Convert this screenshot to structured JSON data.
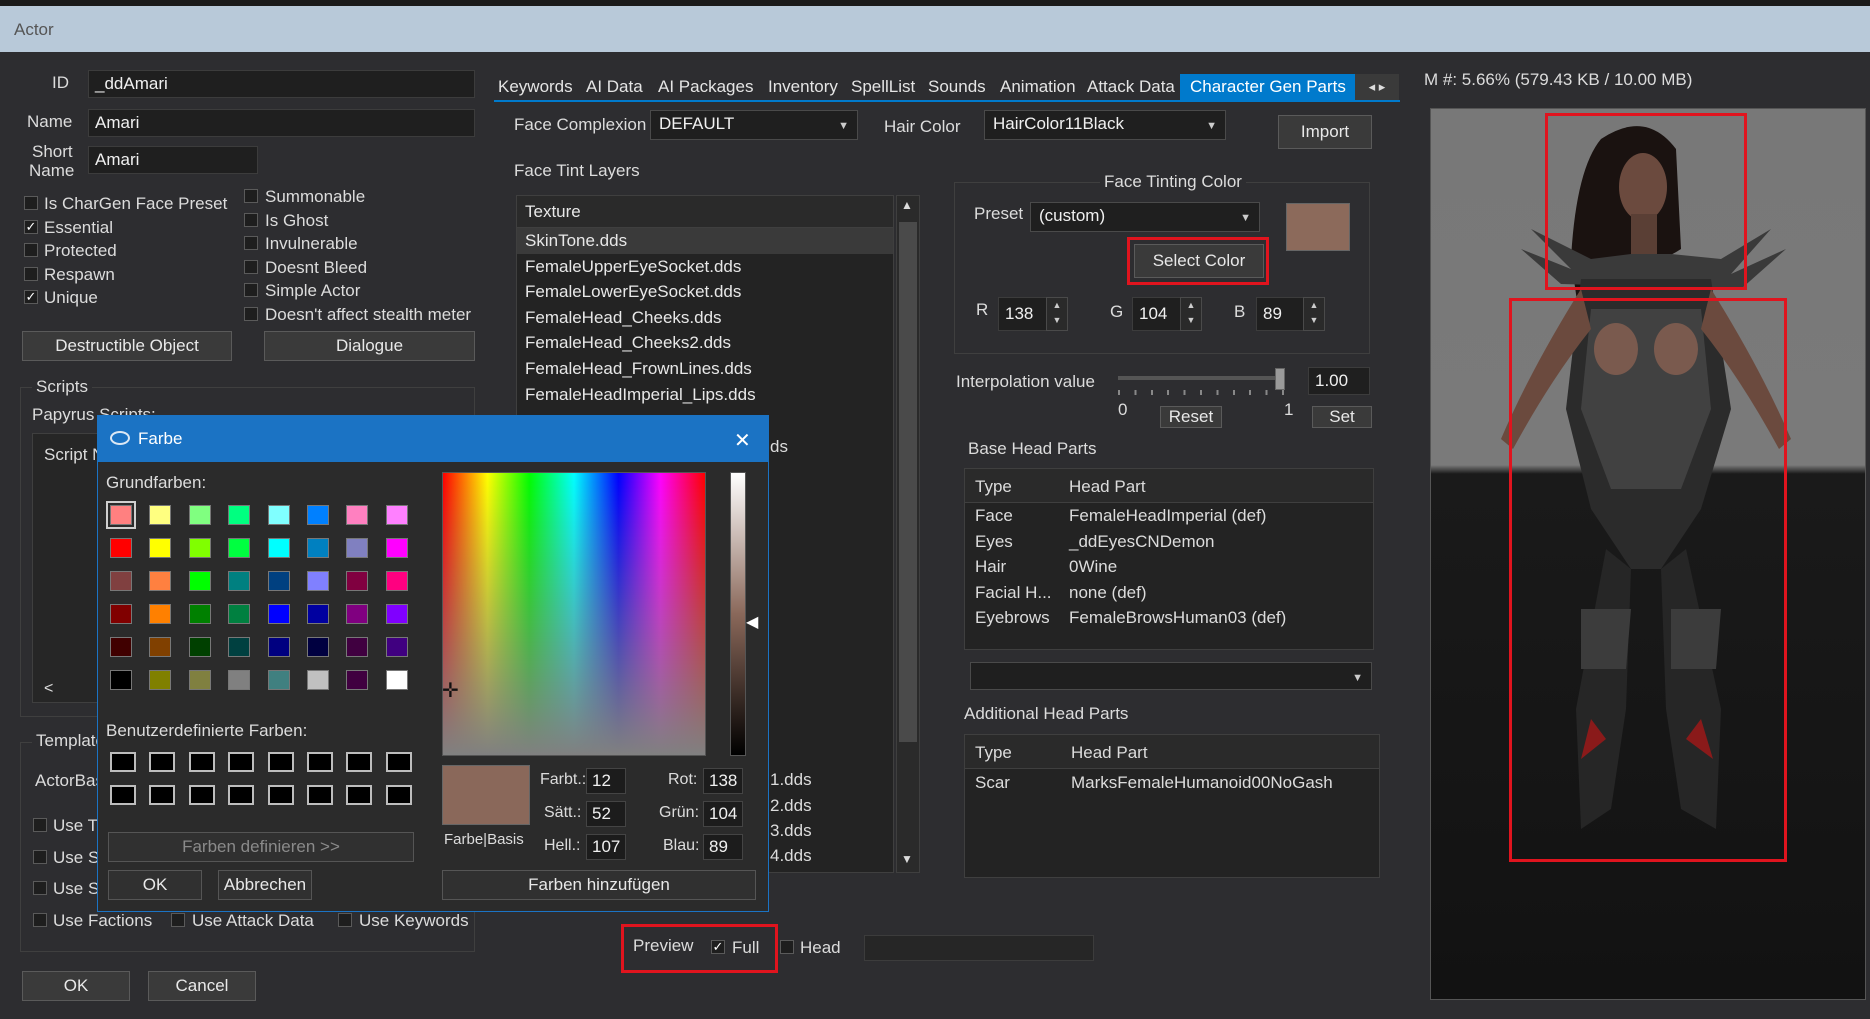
{
  "window": {
    "title": "Actor"
  },
  "actor": {
    "id_label": "ID",
    "id_value": "_ddAmari",
    "name_label": "Name",
    "name_value": "Amari",
    "short_name_label_1": "Short",
    "short_name_label_2": "Name",
    "short_name_value": "Amari"
  },
  "flags_left": [
    {
      "label": "Is CharGen Face Preset",
      "checked": false
    },
    {
      "label": "Essential",
      "checked": true
    },
    {
      "label": "Protected",
      "checked": false
    },
    {
      "label": "Respawn",
      "checked": false
    },
    {
      "label": "Unique",
      "checked": true
    }
  ],
  "flags_right": [
    {
      "label": "Summonable",
      "checked": false
    },
    {
      "label": "Is Ghost",
      "checked": false
    },
    {
      "label": "Invulnerable",
      "checked": false
    },
    {
      "label": "Doesnt Bleed",
      "checked": false
    },
    {
      "label": "Simple Actor",
      "checked": false
    },
    {
      "label": "Doesn't affect stealth meter",
      "checked": false
    }
  ],
  "buttons": {
    "destructible": "Destructible Object",
    "dialogue": "Dialogue",
    "ok": "OK",
    "cancel": "Cancel",
    "import": "Import",
    "select_color": "Select Color",
    "reset": "Reset",
    "set": "Set"
  },
  "scripts": {
    "group_label": "Scripts",
    "papyrus_label": "Papyrus Scripts:",
    "column": "Script N",
    "scroll_left": "<"
  },
  "template": {
    "group_label": "Template",
    "actorbase_label": "ActorBase",
    "use_rows": [
      "Use T",
      "Use S",
      "Use S"
    ],
    "bottom_flags": [
      "Use Factions",
      "Use Attack Data",
      "Use Keywords"
    ]
  },
  "tabs": [
    "Keywords",
    "AI Data",
    "AI Packages",
    "Inventory",
    "SpellList",
    "Sounds",
    "Animation",
    "Attack Data",
    "Character Gen Parts"
  ],
  "tab_arrows": "◂  ▸",
  "chargen": {
    "face_complexion_label": "Face Complexion",
    "face_complexion_value": "DEFAULT",
    "hair_color_label": "Hair Color",
    "hair_color_value": "HairColor11Black",
    "face_tint_layers_label": "Face Tint Layers",
    "texture_header": "Texture",
    "textures": [
      "SkinTone.dds",
      "FemaleUpperEyeSocket.dds",
      "FemaleLowerEyeSocket.dds",
      "FemaleHead_Cheeks.dds",
      "FemaleHead_Cheeks2.dds",
      "FemaleHead_FrownLines.dds",
      "FemaleHeadImperial_Lips.dds"
    ],
    "texture_fragments": [
      "ds",
      "1.dds",
      "2.dds",
      "3.dds",
      "4.dds"
    ],
    "tint_color_title": "Face Tinting Color",
    "preset_label": "Preset",
    "preset_value": "(custom)",
    "tint_color": "#8c6a5b",
    "r_label": "R",
    "r_value": "138",
    "g_label": "G",
    "g_value": "104",
    "b_label": "B",
    "b_value": "89",
    "interp_label": "Interpolation value",
    "interp_value": "1.00",
    "interp_min": "0",
    "interp_max": "1",
    "interp_level": 1.0,
    "base_head_parts_label": "Base Head Parts",
    "head_cols": [
      "Type",
      "Head Part"
    ],
    "base_head_parts": [
      {
        "type": "Face",
        "part": "FemaleHeadImperial (def)"
      },
      {
        "type": "Eyes",
        "part": "_ddEyesCNDemon"
      },
      {
        "type": "Hair",
        "part": "0Wine"
      },
      {
        "type": "Facial H...",
        "part": "none (def)"
      },
      {
        "type": "Eyebrows",
        "part": "FemaleBrowsHuman03 (def)"
      }
    ],
    "additional_head_parts_label": "Additional Head Parts",
    "additional_head_parts": [
      {
        "type": "Scar",
        "part": "MarksFemaleHumanoid00NoGash"
      }
    ],
    "preview_label": "Preview",
    "full_label": "Full",
    "full_checked": true,
    "head_label": "Head",
    "head_checked": false
  },
  "memory": {
    "text": "M #: 5.66% (579.43 KB / 10.00 MB)"
  },
  "color_dialog": {
    "title": "Farbe",
    "basic_colors_label": "Grundfarben:",
    "basic_colors": [
      "#ff8080",
      "#ffff80",
      "#80ff80",
      "#00ff80",
      "#80ffff",
      "#0080ff",
      "#ff80c0",
      "#ff80ff",
      "#ff0000",
      "#ffff00",
      "#80ff00",
      "#00ff40",
      "#00ffff",
      "#0080c0",
      "#8080c0",
      "#ff00ff",
      "#804040",
      "#ff8040",
      "#00ff00",
      "#008080",
      "#004080",
      "#8080ff",
      "#800040",
      "#ff0080",
      "#800000",
      "#ff8000",
      "#008000",
      "#008040",
      "#0000ff",
      "#0000a0",
      "#800080",
      "#8000ff",
      "#400000",
      "#804000",
      "#004000",
      "#004040",
      "#000080",
      "#000040",
      "#400040",
      "#400080",
      "#000000",
      "#808000",
      "#808040",
      "#808080",
      "#408080",
      "#c0c0c0",
      "#400040",
      "#ffffff"
    ],
    "custom_colors_label": "Benutzerdefinierte Farben:",
    "define_colors": "Farben definieren >>",
    "ok": "OK",
    "cancel": "Abbrechen",
    "color_solid_label": "Farbe|Basis",
    "hue_label": "Farbt.:",
    "hue_value": "12",
    "sat_label": "Sätt.:",
    "sat_value": "52",
    "lum_label": "Hell.:",
    "lum_value": "107",
    "red_label": "Rot:",
    "red_value": "138",
    "green_label": "Grün:",
    "green_value": "104",
    "blue_label": "Blau:",
    "blue_value": "89",
    "add_colors": "Farben hinzufügen",
    "current_color": "#8a685a",
    "close_glyph": "✕"
  },
  "icons": {
    "close": "close-icon",
    "dropdown": "chevron-down-icon",
    "app": "color-dialog-icon"
  }
}
